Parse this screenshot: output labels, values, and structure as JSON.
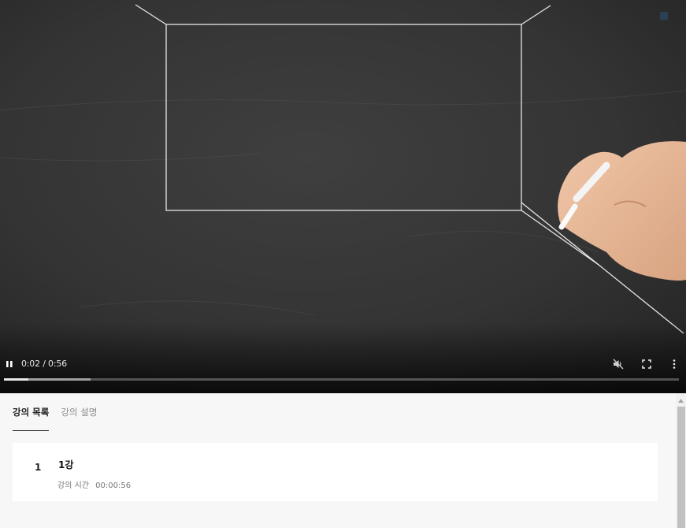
{
  "player": {
    "current_time": "0:02",
    "duration": "0:56",
    "time_separator": " / ",
    "progress_played_fraction": 0.036,
    "progress_buffered_fraction": 0.128,
    "icons": {
      "pause": "pause-icon",
      "mute": "volume-muted-icon",
      "fullscreen": "fullscreen-icon",
      "more": "more-vertical-icon"
    }
  },
  "tabs": [
    {
      "label": "강의 목록",
      "active": true
    },
    {
      "label": "강의 설명",
      "active": false
    }
  ],
  "lessons": [
    {
      "number": "1",
      "title": "1강",
      "duration_label": "강의 시간",
      "duration": "00:00:56"
    }
  ],
  "colors": {
    "tab_active": "#222222",
    "tab_inactive": "#8a8a8a",
    "panel_background": "#f7f7f7",
    "card_background": "#ffffff"
  }
}
